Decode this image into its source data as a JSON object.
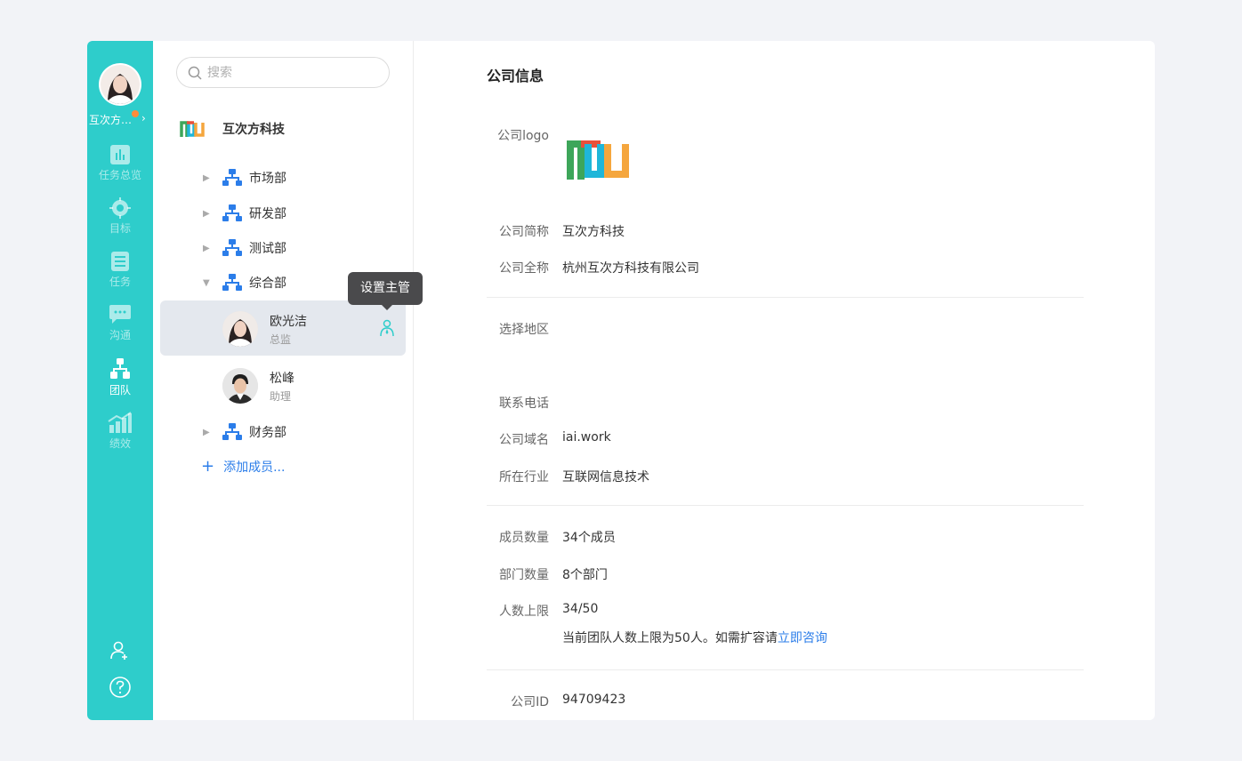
{
  "rail": {
    "company_name": "互次方…",
    "items": [
      {
        "label": "任务总览",
        "icon": "chart-icon"
      },
      {
        "label": "目标",
        "icon": "target-icon"
      },
      {
        "label": "任务",
        "icon": "task-list-icon"
      },
      {
        "label": "沟通",
        "icon": "chat-icon"
      },
      {
        "label": "团队",
        "icon": "team-icon"
      },
      {
        "label": "绩效",
        "icon": "performance-icon"
      }
    ],
    "active": "团队"
  },
  "tree": {
    "search_placeholder": "搜索",
    "org_name": "互次方科技",
    "departments": [
      "市场部",
      "研发部",
      "测试部",
      "综合部",
      "财务部"
    ],
    "members": [
      {
        "name": "欧光洁",
        "role": "总监"
      },
      {
        "name": "松峰",
        "role": "助理"
      }
    ],
    "tooltip": "设置主管",
    "add_member": "添加成员..."
  },
  "info": {
    "title": "公司信息",
    "logo_label": "公司logo",
    "short_name_label": "公司简称",
    "short_name": "互次方科技",
    "full_name_label": "公司全称",
    "full_name": "杭州互次方科技有限公司",
    "region_label": "选择地区",
    "phone_label": "联系电话",
    "domain_label": "公司域名",
    "domain": "iai.work",
    "industry_label": "所在行业",
    "industry": "互联网信息技术",
    "members_label": "成员数量",
    "members": "34个成员",
    "depts_label": "部门数量",
    "depts": "8个部门",
    "limit_label": "人数上限",
    "limit": "34/50",
    "limit_note": "当前团队人数上限为50人。如需扩容请",
    "limit_link": "立即咨询",
    "id_label": "公司ID",
    "id": "94709423"
  },
  "colors": {
    "rail": "#2ecdcb",
    "accent": "#2b7de9",
    "badge": "#ff8c3a"
  }
}
